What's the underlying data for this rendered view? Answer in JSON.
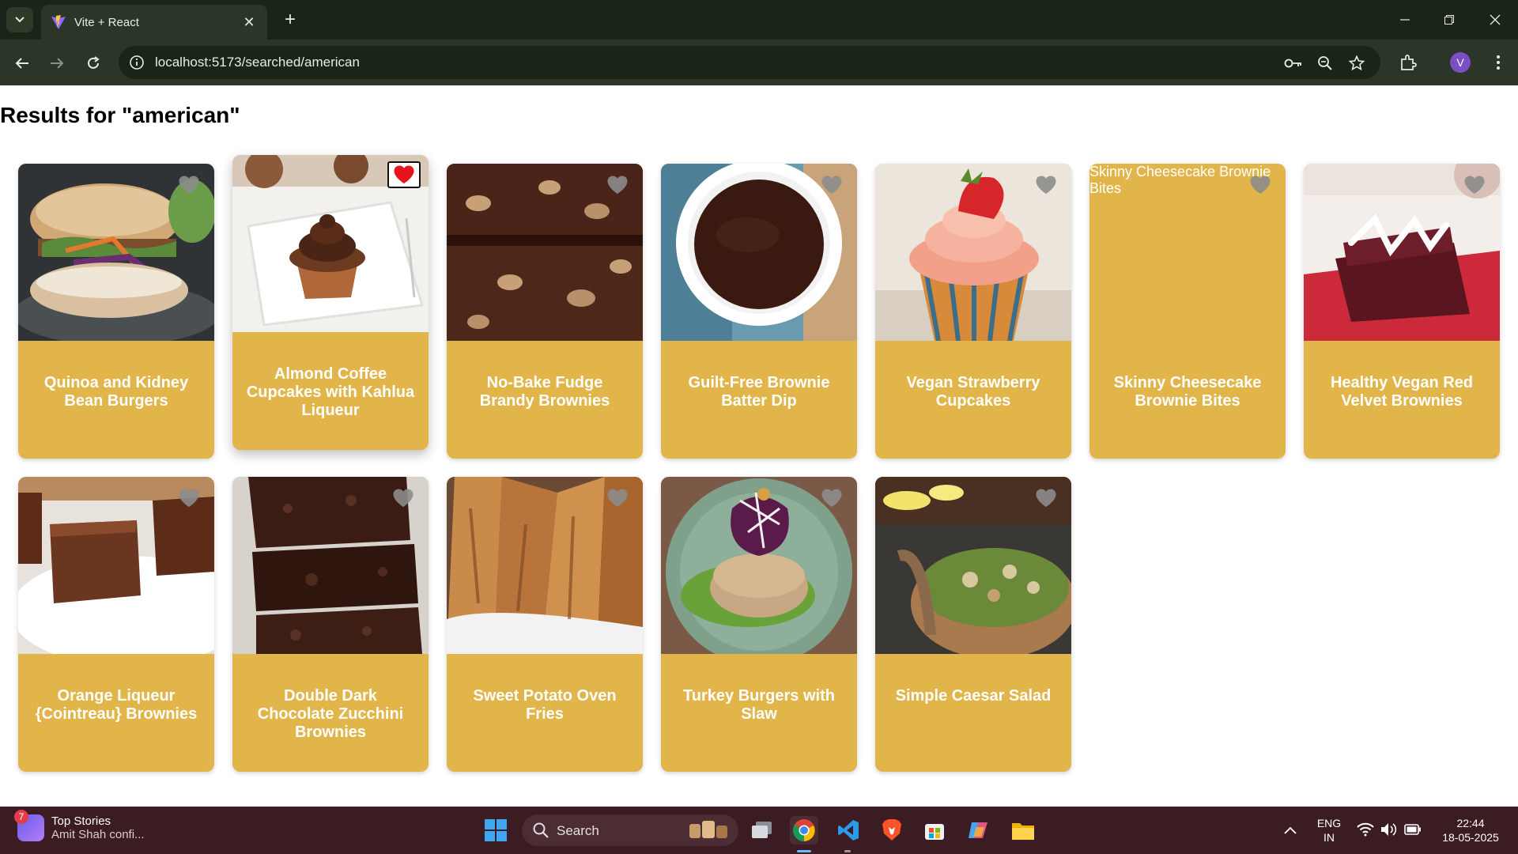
{
  "browser": {
    "tab_title": "Vite + React",
    "url": "localhost:5173/searched/american",
    "profile_initial": "V",
    "icons": [
      "tab-search-icon",
      "vite-favicon",
      "close-icon",
      "plus-icon",
      "minimize-icon",
      "restore-icon",
      "window-close-icon",
      "back-icon",
      "forward-icon",
      "reload-icon",
      "site-info-icon",
      "password-key-icon",
      "zoom-icon",
      "bookmark-star-icon",
      "extensions-icon",
      "more-menu-icon"
    ]
  },
  "page": {
    "heading": "Results for \"american\""
  },
  "recipes": [
    {
      "name": "Quinoa and Kidney Bean Burgers",
      "favorite": false,
      "image": "burger"
    },
    {
      "name": "Almond Coffee Cupcakes with Kahlua Liqueur",
      "favorite": true,
      "image": "cupcake-chocolate"
    },
    {
      "name": "No-Bake Fudge Brandy Brownies",
      "favorite": false,
      "image": "fudge"
    },
    {
      "name": "Guilt-Free Brownie Batter Dip",
      "favorite": false,
      "image": "dip"
    },
    {
      "name": "Vegan Strawberry Cupcakes",
      "favorite": false,
      "image": "cupcake-strawberry"
    },
    {
      "name": "Skinny Cheesecake Brownie Bites",
      "favorite": false,
      "image": "broken",
      "alt": "Skinny Cheesecake Brownie Bites"
    },
    {
      "name": "Healthy Vegan Red Velvet Brownies",
      "favorite": false,
      "image": "red-velvet"
    },
    {
      "name": "Orange Liqueur {Cointreau} Brownies",
      "favorite": false,
      "image": "brownie-plate"
    },
    {
      "name": "Double Dark Chocolate Zucchini Brownies",
      "favorite": false,
      "image": "brownie-stack"
    },
    {
      "name": "Sweet Potato Oven Fries",
      "favorite": false,
      "image": "fries"
    },
    {
      "name": "Turkey Burgers with Slaw",
      "favorite": false,
      "image": "turkey-burger"
    },
    {
      "name": "Simple Caesar Salad",
      "favorite": false,
      "image": "salad"
    }
  ],
  "taskbar": {
    "news_badge": "7",
    "news_title": "Top Stories",
    "news_subtitle": "Amit Shah confi...",
    "search_label": "Search",
    "lang_line1": "ENG",
    "lang_line2": "IN",
    "time": "22:44",
    "date": "18-05-2025",
    "apps": [
      "windows-start-icon",
      "task-view-icon",
      "chrome-icon",
      "vscode-icon",
      "brave-icon",
      "store-icon",
      "copilot-icon",
      "file-explorer-icon"
    ]
  },
  "colors": {
    "card": "#e2b54a",
    "favorite_heart": "#e8141d",
    "heart_inactive": "#8c8c8c",
    "tab_bg": "#1a2418",
    "toolbar_bg": "#2b3628",
    "taskbar_bg": "#3b1c22"
  }
}
